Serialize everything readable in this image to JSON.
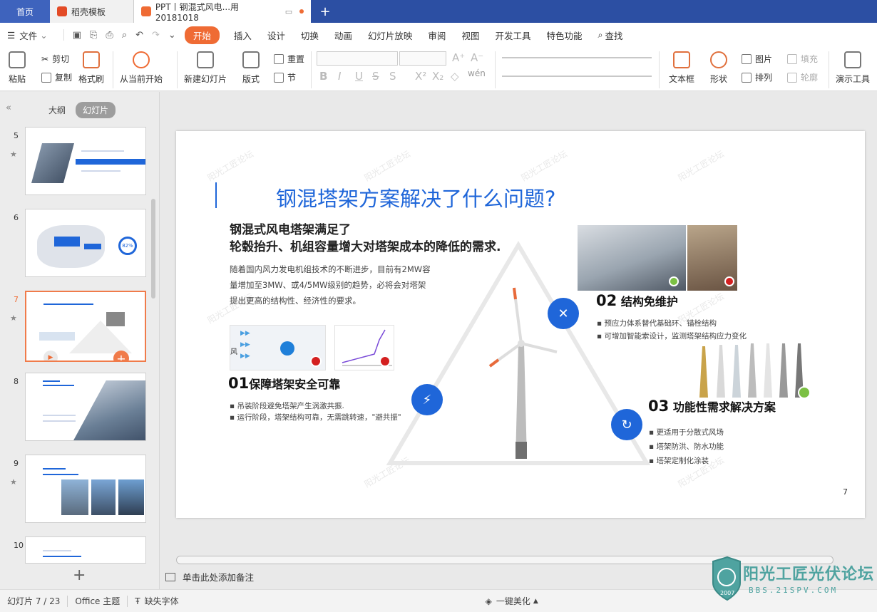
{
  "tabs": {
    "home": "首页",
    "template": "稻壳模板",
    "doc": "PPT丨钢混式风电...用20181018"
  },
  "menu": {
    "file": "文件",
    "items": [
      "开始",
      "插入",
      "设计",
      "切换",
      "动画",
      "幻灯片放映",
      "审阅",
      "视图",
      "开发工具",
      "特色功能",
      "查找"
    ]
  },
  "ribbon": {
    "paste": "粘贴",
    "cut": "剪切",
    "copy": "复制",
    "format_painter": "格式刷",
    "from_current": "从当前开始",
    "new_slide": "新建幻灯片",
    "layout": "版式",
    "reset": "重置",
    "section": "节",
    "textbox": "文本框",
    "shape": "形状",
    "image": "图片",
    "fill": "填充",
    "arrange": "排列",
    "outline": "轮廓",
    "present_tools": "演示工具"
  },
  "left_panel": {
    "outline_tab": "大纲",
    "slides_tab": "幻灯片",
    "slide_numbers": [
      "5",
      "6",
      "7",
      "8",
      "9",
      "10"
    ],
    "thumb6_percent": "82%"
  },
  "slide": {
    "title": "钢混塔架方案解决了什么问题?",
    "subhead_line1": "钢混式风电塔架满足了",
    "subhead_line2": "轮毂抬升、机组容量增大对塔架成本的降低的需求.",
    "para_line1": "随着国内风力发电机组技术的不断进步，目前有2MW容",
    "para_line2": "量增加至3MW、或4/5MW级别的趋势，必将会对塔架",
    "para_line3": "提出更高的结构性、经济性的要求。",
    "wind_label": "风",
    "sec1_num": "01",
    "sec1_title": "保障塔架安全可靠",
    "sec1_bullets": [
      "吊装阶段避免塔架产生涡激共振.",
      "运行阶段，塔架结构可靠，无需跳转速，\"避共振\""
    ],
    "sec2_num": "02",
    "sec2_title": "结构免维护",
    "sec2_bullets": [
      "预应力体系替代基础环、锚栓结构",
      "可增加智能索设计，监测塔架结构应力变化"
    ],
    "sec3_num": "03",
    "sec3_title": "功能性需求解决方案",
    "sec3_bullets": [
      "更适用于分散式风场",
      "塔架防洪、防水功能",
      "塔架定制化涂装"
    ],
    "page_number": "7",
    "watermark": "阳光工匠论坛"
  },
  "notes_placeholder": "单击此处添加备注",
  "status": {
    "slide_counter": "幻灯片 7 / 23",
    "theme": "Office 主题",
    "missing_fonts": "缺失字体",
    "beautify": "一键美化"
  },
  "logo": {
    "name": "阳光工匠光伏论坛",
    "url": "BBS.21SPV.COM",
    "year": "2007"
  },
  "colors": {
    "accent": "#ef6b34",
    "brand_blue": "#1f66d9",
    "tabbar": "#2c4fa3"
  }
}
